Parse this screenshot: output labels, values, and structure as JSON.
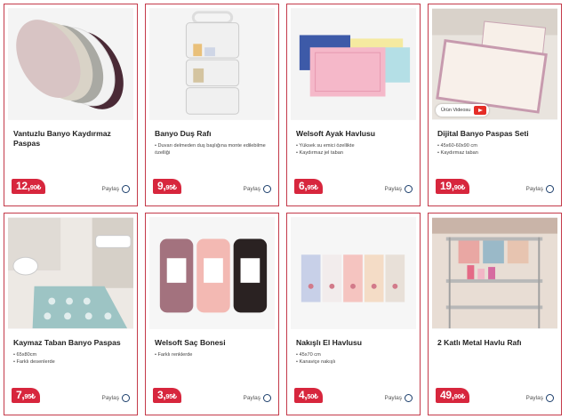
{
  "products": [
    {
      "title": "Vantuzlu Banyo Kaydırmaz Paspas",
      "features": [],
      "price_int": "12,",
      "price_dec": "90₺",
      "share": "Paylaş"
    },
    {
      "title": "Banyo Duş Rafı",
      "features": [
        "Duvarı delmeden duş başlığına monte edilebilme özelliği"
      ],
      "price_int": "9,",
      "price_dec": "95₺",
      "share": "Paylaş"
    },
    {
      "title": "Welsoft Ayak Havlusu",
      "features": [
        "Yüksek su emici özellikte",
        "Kaydırmaz jel taban"
      ],
      "price_int": "6,",
      "price_dec": "95₺",
      "share": "Paylaş"
    },
    {
      "title": "Dijital Banyo Paspas Seti",
      "features": [
        "45x60-60x90 cm",
        "Kaydırmaz taban"
      ],
      "price_int": "19,",
      "price_dec": "90₺",
      "share": "Paylaş",
      "video": "Ürün Videosu"
    },
    {
      "title": "Kaymaz Taban Banyo Paspas",
      "features": [
        "65x80cm",
        "Farklı desenlerde"
      ],
      "price_int": "7,",
      "price_dec": "95₺",
      "share": "Paylaş"
    },
    {
      "title": "Welsoft Saç Bonesi",
      "features": [
        "Farklı renklerde"
      ],
      "price_int": "3,",
      "price_dec": "95₺",
      "share": "Paylaş"
    },
    {
      "title": "Nakışlı El Havlusu",
      "features": [
        "45x70 cm",
        "Kanaviçe nakışlı"
      ],
      "price_int": "4,",
      "price_dec": "50₺",
      "share": "Paylaş"
    },
    {
      "title": "2 Katlı Metal Havlu Rafı",
      "features": [],
      "price_int": "49,",
      "price_dec": "90₺",
      "share": "Paylaş"
    }
  ],
  "colors": {
    "accent": "#d7263d",
    "border": "#c43a4a",
    "share_icon": "#1a3d6b"
  }
}
